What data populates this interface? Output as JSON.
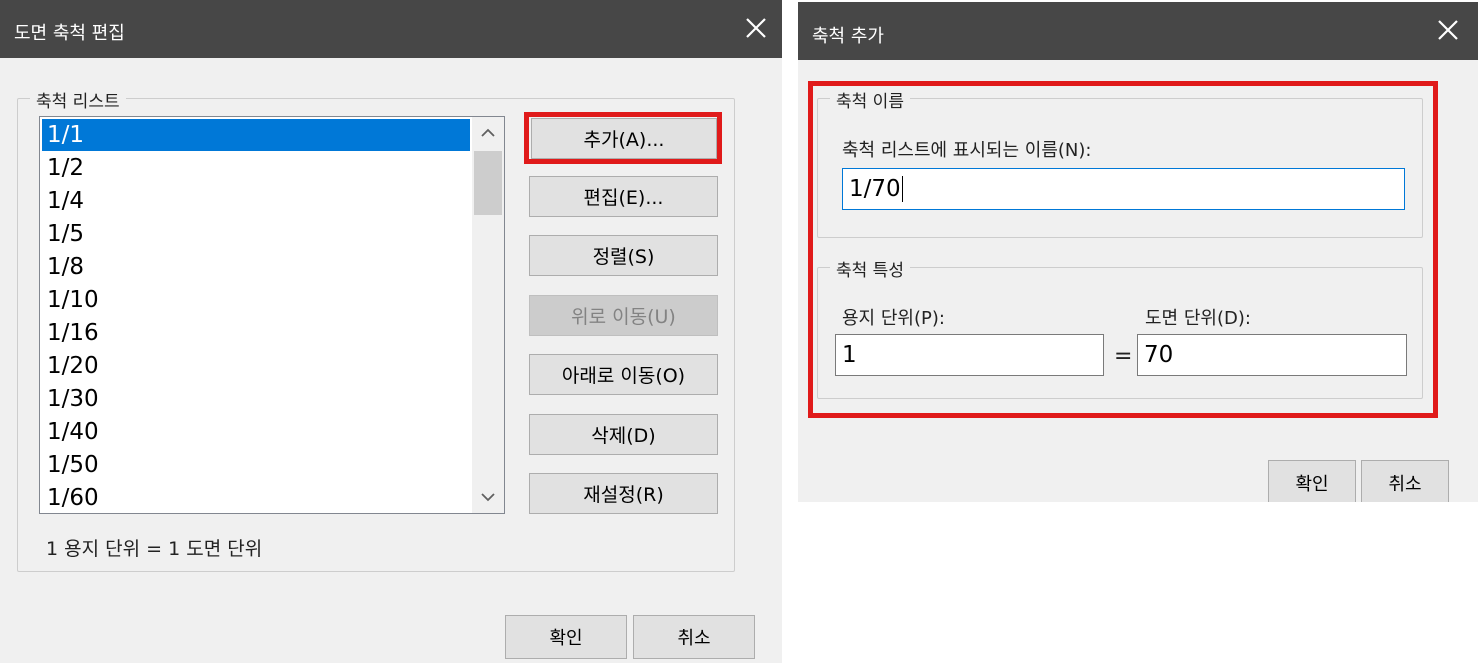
{
  "left_dialog": {
    "title": "도면 축척 편집",
    "group_label": "축척 리스트",
    "items": [
      "1/1",
      "1/2",
      "1/4",
      "1/5",
      "1/8",
      "1/10",
      "1/16",
      "1/20",
      "1/30",
      "1/40",
      "1/50",
      "1/60"
    ],
    "selected_index": 0,
    "buttons": {
      "add": "추가(A)...",
      "edit": "편집(E)...",
      "sort": "정렬(S)",
      "move_up": "위로 이동(U)",
      "move_down": "아래로 이동(O)",
      "delete": "삭제(D)",
      "reset": "재설정(R)"
    },
    "ratio_text": "1 용지 단위 = 1 도면 단위",
    "ok": "확인",
    "cancel": "취소"
  },
  "right_dialog": {
    "title": "축척 추가",
    "name_group": "축척 이름",
    "name_label": "축척 리스트에 표시되는 이름(N):",
    "name_value": "1/70",
    "props_group": "축척 특성",
    "paper_label": "용지 단위(P):",
    "drawing_label": "도면 단위(D):",
    "paper_value": "1",
    "equals": "=",
    "drawing_value": "70",
    "ok": "확인",
    "cancel": "취소"
  },
  "colors": {
    "highlight": "#e01a1a",
    "selection": "#0078d7",
    "titlebar": "#474747"
  }
}
